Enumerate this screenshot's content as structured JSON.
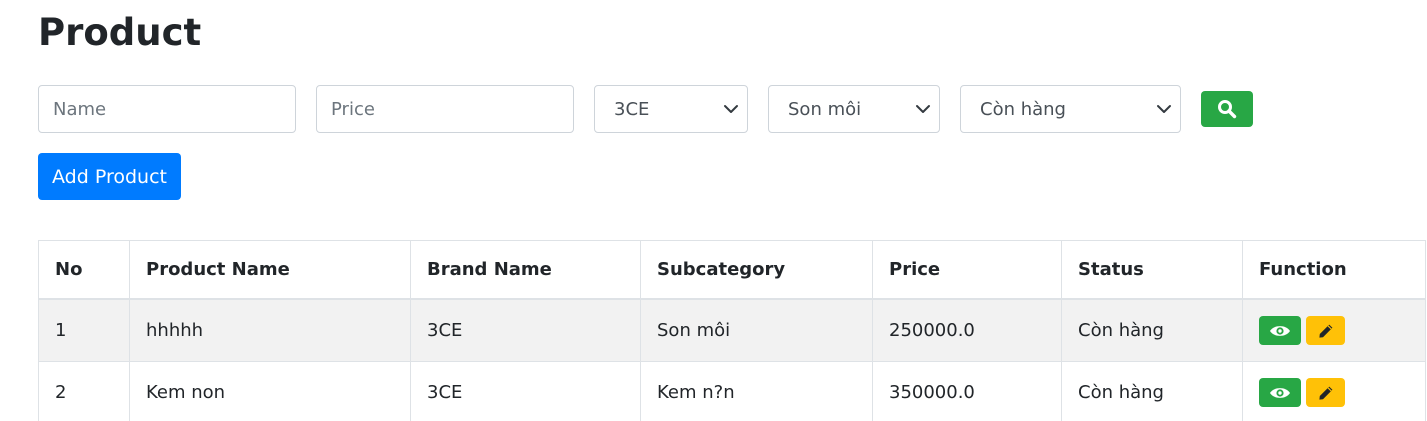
{
  "header": {
    "title": "Product"
  },
  "filters": {
    "name_placeholder": "Name",
    "name_value": "",
    "price_placeholder": "Price",
    "price_value": "",
    "brand_selected": "3CE",
    "subcategory_selected": "Son môi",
    "status_selected": "Còn hàng",
    "search_icon": "magnifier-icon"
  },
  "actions": {
    "add_label": "Add Product"
  },
  "table": {
    "headers": {
      "no": "No",
      "product_name": "Product Name",
      "brand_name": "Brand Name",
      "subcategory": "Subcategory",
      "price": "Price",
      "status": "Status",
      "function": "Function"
    },
    "rows": [
      {
        "no": "1",
        "product_name": "hhhhh",
        "brand_name": "3CE",
        "subcategory": "Son môi",
        "price": "250000.0",
        "status": "Còn hàng"
      },
      {
        "no": "2",
        "product_name": "Kem non",
        "brand_name": "3CE",
        "subcategory": "Kem n?n",
        "price": "350000.0",
        "status": "Còn hàng"
      }
    ],
    "function_icons": {
      "view": "eye-icon",
      "edit": "pencil-icon"
    }
  },
  "colors": {
    "primary": "#007bff",
    "success": "#28a745",
    "warning": "#ffc107",
    "row_stripe": "#f2f2f2",
    "border": "#dee2e6"
  }
}
